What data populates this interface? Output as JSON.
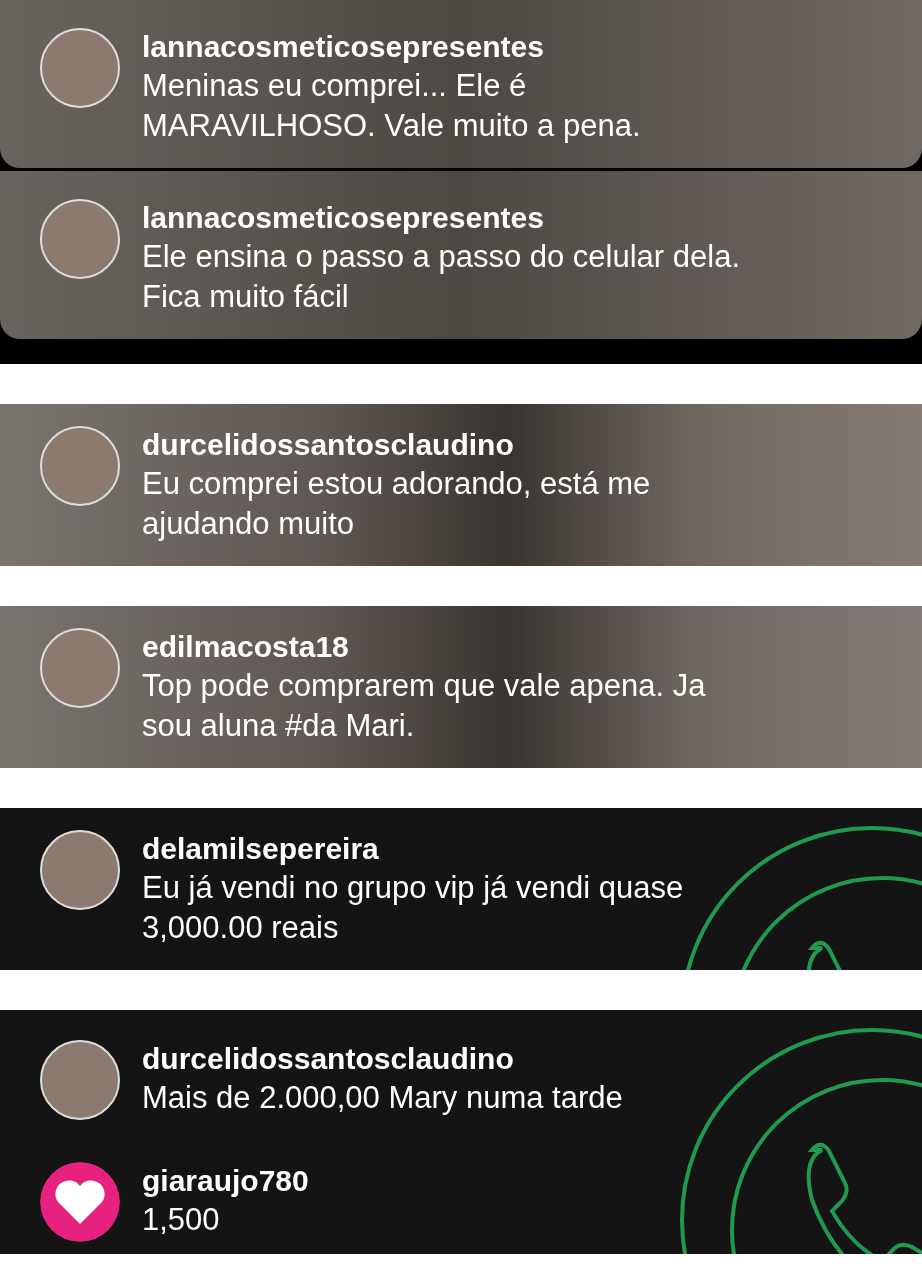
{
  "panels": [
    {
      "kind": "bubbles",
      "comments": [
        {
          "username": "lannacosmeticosepresentes",
          "text": "Meninas eu comprei... Ele é MARAVILHOSO. Vale muito a pena.",
          "kind": "photo"
        },
        {
          "username": "lannacosmeticosepresentes",
          "text": "Ele ensina o passo a passo do celular dela. Fica muito fácil",
          "kind": "photo"
        }
      ]
    },
    {
      "kind": "video",
      "comments": [
        {
          "username": "durcelidossantosclaudino",
          "text": "Eu comprei estou adorando, está me ajudando muito",
          "kind": "photo"
        }
      ]
    },
    {
      "kind": "video",
      "comments": [
        {
          "username": "edilmacosta18",
          "text": "Top pode comprarem que  vale apena. Ja sou aluna #da Mari.",
          "kind": "photo"
        }
      ]
    },
    {
      "kind": "dark",
      "comments": [
        {
          "username": "delamilsepereira",
          "text": "Eu já vendi no grupo vip já vendi quase 3,000.00 reais",
          "kind": "photo"
        }
      ]
    },
    {
      "kind": "dark",
      "comments": [
        {
          "username": "durcelidossantosclaudino",
          "text": "Mais de 2.000,00 Mary numa tarde",
          "kind": "photo"
        },
        {
          "username": "giaraujo780",
          "text": "1,500",
          "kind": "heart"
        }
      ]
    }
  ]
}
